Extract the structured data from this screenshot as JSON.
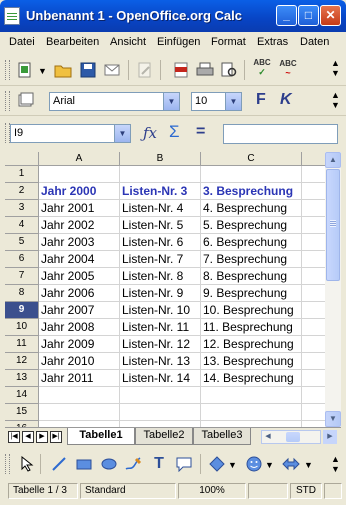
{
  "window": {
    "title": "Unbenannt 1 - OpenOffice.org Calc",
    "min": "_",
    "max": "□",
    "close": "✕"
  },
  "menu": [
    "Datei",
    "Bearbeiten",
    "Ansicht",
    "Einfügen",
    "Format",
    "Extras",
    "Daten"
  ],
  "formatting": {
    "font": "Arial",
    "size": "10",
    "bold": "F",
    "italic": "K"
  },
  "formulabar": {
    "cellref": "I9",
    "sum": "Σ",
    "equals": "=",
    "value": ""
  },
  "sheet": {
    "columns": [
      "A",
      "B",
      "C"
    ],
    "rows": [
      {
        "n": "1",
        "cells": [
          "",
          "",
          ""
        ]
      },
      {
        "n": "2",
        "cells": [
          "Jahr 2000",
          "Listen-Nr. 3",
          "3. Besprechung"
        ],
        "header": true
      },
      {
        "n": "3",
        "cells": [
          "Jahr 2001",
          "Listen-Nr. 4",
          "4. Besprechung"
        ]
      },
      {
        "n": "4",
        "cells": [
          "Jahr 2002",
          "Listen-Nr. 5",
          "5. Besprechung"
        ]
      },
      {
        "n": "5",
        "cells": [
          "Jahr 2003",
          "Listen-Nr. 6",
          "6. Besprechung"
        ]
      },
      {
        "n": "6",
        "cells": [
          "Jahr 2004",
          "Listen-Nr. 7",
          "7. Besprechung"
        ]
      },
      {
        "n": "7",
        "cells": [
          "Jahr 2005",
          "Listen-Nr. 8",
          "8. Besprechung"
        ]
      },
      {
        "n": "8",
        "cells": [
          "Jahr 2006",
          "Listen-Nr. 9",
          "9. Besprechung"
        ]
      },
      {
        "n": "9",
        "cells": [
          "Jahr 2007",
          "Listen-Nr. 10",
          "10. Besprechung"
        ],
        "active": true
      },
      {
        "n": "10",
        "cells": [
          "Jahr 2008",
          "Listen-Nr. 11",
          "11. Besprechung"
        ]
      },
      {
        "n": "11",
        "cells": [
          "Jahr 2009",
          "Listen-Nr. 12",
          "12. Besprechung"
        ]
      },
      {
        "n": "12",
        "cells": [
          "Jahr 2010",
          "Listen-Nr. 13",
          "13. Besprechung"
        ]
      },
      {
        "n": "13",
        "cells": [
          "Jahr 2011",
          "Listen-Nr. 14",
          "14. Besprechung"
        ]
      },
      {
        "n": "14",
        "cells": [
          "",
          "",
          ""
        ]
      },
      {
        "n": "15",
        "cells": [
          "",
          "",
          ""
        ]
      },
      {
        "n": "16",
        "cells": [
          "",
          "",
          ""
        ]
      }
    ]
  },
  "tabs": [
    "Tabelle1",
    "Tabelle2",
    "Tabelle3"
  ],
  "status": {
    "sheet": "Tabelle 1 / 3",
    "style": "Standard",
    "zoom": "100%",
    "mode": "STD"
  },
  "colors": {
    "header_text": "#2b35b5",
    "titlebar": "#0a5fe6",
    "active_row": "#3b4f8d"
  }
}
